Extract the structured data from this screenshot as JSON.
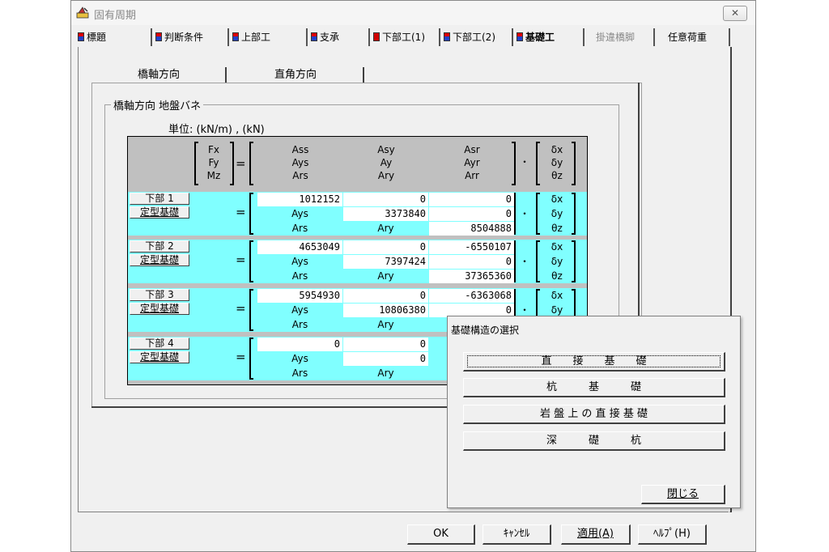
{
  "window": {
    "title": "固有周期",
    "close_glyph": "✕"
  },
  "tabs": [
    {
      "label": "標題",
      "icon": "blue-red-icon"
    },
    {
      "label": "判断条件",
      "icon": "blue-red-icon"
    },
    {
      "label": "上部工",
      "icon": "blue-red-icon"
    },
    {
      "label": "支承",
      "icon": "blue-red-icon"
    },
    {
      "label": "下部工(1)",
      "icon": "red-icon"
    },
    {
      "label": "下部工(2)",
      "icon": "blue-red-icon"
    },
    {
      "label": "基礎工",
      "icon": "blue-red-icon",
      "active": true
    },
    {
      "label": "掛違橋脚",
      "disabled": true
    },
    {
      "label": "任意荷重"
    }
  ],
  "subtabs": [
    "橋軸方向",
    "直角方向"
  ],
  "group_title": "橋軸方向 地盤バネ",
  "unit": "単位:  (kN/m) ,  (kN)",
  "header": {
    "force": [
      "Fx",
      "Fy",
      "Mz"
    ],
    "eq": "=",
    "col1": [
      "Ass",
      "Ays",
      "Ars"
    ],
    "col2": [
      "Asy",
      "Ay",
      "Ary"
    ],
    "col3": [
      "Asr",
      "Ayr",
      "Arr"
    ],
    "dot": "・",
    "disp": [
      "δx",
      "δy",
      "θz"
    ]
  },
  "rows": [
    {
      "name": "下部 1",
      "btn": "定型基礎",
      "r1": [
        "1012152",
        "0",
        "0"
      ],
      "r2": [
        "Ays",
        "3373840",
        "0"
      ],
      "r3": [
        "Ars",
        "Ary",
        "8504888"
      ],
      "disp": [
        "δx",
        "δy",
        "θz"
      ]
    },
    {
      "name": "下部 2",
      "btn": "定型基礎",
      "r1": [
        "4653049",
        "0",
        "-6550107"
      ],
      "r2": [
        "Ays",
        "7397424",
        "0"
      ],
      "r3": [
        "Ars",
        "Ary",
        "37365360"
      ],
      "disp": [
        "δx",
        "δy",
        "θz"
      ]
    },
    {
      "name": "下部 3",
      "btn": "定型基礎",
      "r1": [
        "5954930",
        "0",
        "-6363068"
      ],
      "r2": [
        "Ays",
        "10806380",
        "0"
      ],
      "r3": [
        "Ars",
        "Ary",
        ""
      ],
      "disp": [
        "δx",
        "δy",
        ""
      ]
    },
    {
      "name": "下部 4",
      "btn": "定型基礎",
      "r1": [
        "0",
        "0",
        ""
      ],
      "r2": [
        "Ays",
        "0",
        ""
      ],
      "r3": [
        "Ars",
        "Ary",
        ""
      ],
      "disp": [
        "",
        "",
        ""
      ]
    }
  ],
  "popup": {
    "title": "基礎構造の選択",
    "options": [
      "直　　接　　基　　礎",
      "杭　　　基　　　礎",
      "岩 盤 上 の 直 接 基 礎",
      "深　　　礎　　　杭"
    ],
    "close": "閉じる"
  },
  "buttons": {
    "ok": "OK",
    "cancel": "ｷｬﾝｾﾙ",
    "apply": "適用(A)",
    "help": "ﾍﾙﾌﾟ(H)"
  },
  "colors": {
    "cyan": "#80ffff",
    "header_gray": "#c0c0c0",
    "dialog": "#f0f0f0"
  }
}
